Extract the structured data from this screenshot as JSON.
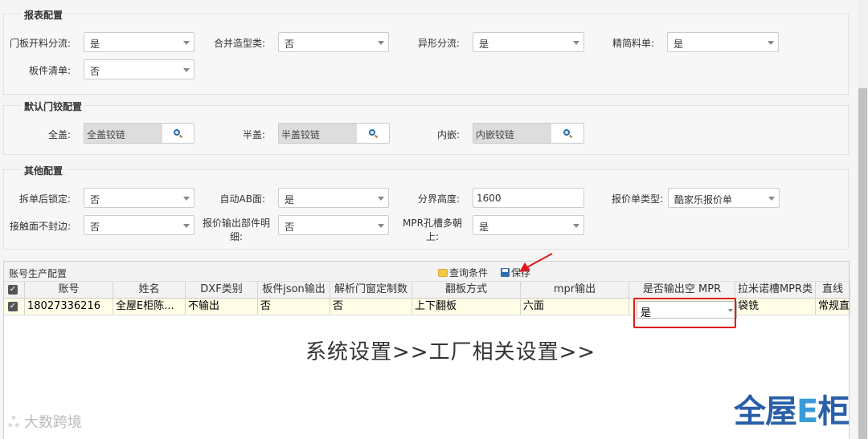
{
  "report_config": {
    "legend": "报表配置",
    "fields": [
      {
        "label": "门板开料分流:",
        "value": "是"
      },
      {
        "label": "合并造型类:",
        "value": "否"
      },
      {
        "label": "异形分流:",
        "value": "是"
      },
      {
        "label": "精简料单:",
        "value": "是"
      },
      {
        "label": "板件清单:",
        "value": "否"
      }
    ]
  },
  "hinge_config": {
    "legend": "默认门铰配置",
    "fields": [
      {
        "label": "全盖:",
        "value": "全盖铰链"
      },
      {
        "label": "半盖:",
        "value": "半盖铰链"
      },
      {
        "label": "内嵌:",
        "value": "内嵌铰链"
      }
    ]
  },
  "other_config": {
    "legend": "其他配置",
    "fields": [
      {
        "label": "拆单后锁定:",
        "value": "否"
      },
      {
        "label": "自动AB面:",
        "value": "是"
      },
      {
        "label": "分界高度:",
        "value": "1600"
      },
      {
        "label": "报价单类型:",
        "value": "酷家乐报价单"
      },
      {
        "label": "接触面不封边:",
        "value": "否"
      },
      {
        "label": "报价输出部件明细:",
        "value": "否"
      },
      {
        "label": "MPR孔槽多朝上:",
        "value": "是"
      }
    ]
  },
  "grid": {
    "title": "账号生产配置",
    "query_label": "查询条件",
    "save_label": "保存",
    "columns": [
      "账号",
      "姓名",
      "DXF类别",
      "板件json输出",
      "解析门窗定制数",
      "翻板方式",
      "mpr输出",
      "是否输出空 MPR",
      "拉米诺槽MPR类",
      "直线"
    ],
    "row": [
      "18027336216",
      "全屋E柜陈...",
      "不输出",
      "否",
      "否",
      "上下翻板",
      "六面",
      "是",
      "袋铣",
      "常规直"
    ]
  },
  "caption": "系统设置>>工厂相关设置>>",
  "watermark": "大数跨境",
  "logo": {
    "part1": "全屋",
    "part2": "E",
    "part3": "柜"
  },
  "colors": {
    "highlight_border": "#e01818",
    "selected_row": "#fffde6",
    "logo": "#2a5fa8"
  }
}
